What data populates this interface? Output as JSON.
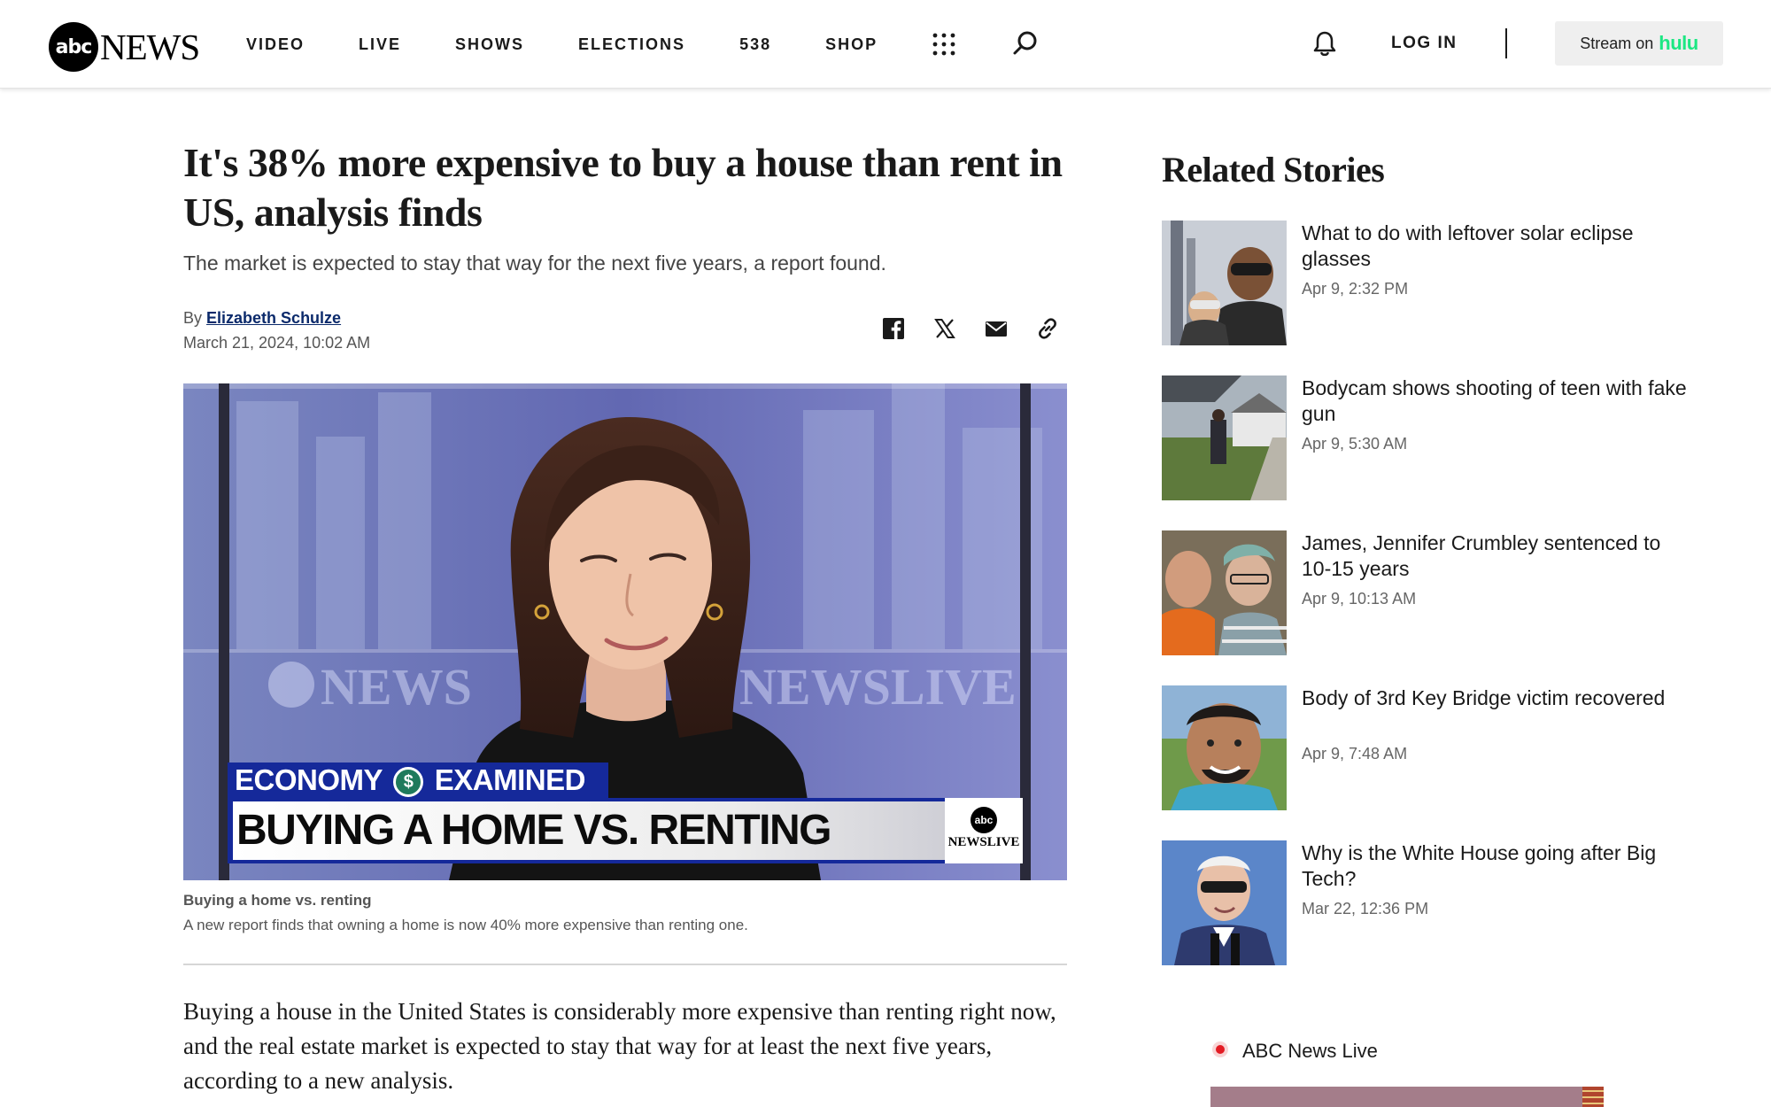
{
  "header": {
    "logo_mark": "abc",
    "logo_word": "NEWS",
    "nav": [
      "VIDEO",
      "LIVE",
      "SHOWS",
      "ELECTIONS",
      "538",
      "SHOP"
    ],
    "login_label": "LOG IN",
    "stream_prefix": "Stream on",
    "stream_brand": "hulu",
    "icons": [
      "grid-menu-icon",
      "search-icon",
      "bell-icon"
    ]
  },
  "article": {
    "headline": "It's 38% more expensive to buy a house than rent in US, analysis finds",
    "subhead": "The market is expected to stay that way for the next five years, a report found.",
    "byline_prefix": "By",
    "author": "Elizabeth Schulze",
    "date": "March 21, 2024, 10:02 AM",
    "share_icons": [
      "facebook-icon",
      "x-icon",
      "email-icon",
      "link-icon"
    ],
    "hero": {
      "lower_third_top_left": "ECONOMY",
      "lower_third_symbol": "$",
      "lower_third_top_right": "EXAMINED",
      "lower_third_main": "BUYING A HOME VS. RENTING",
      "badge_mark": "abc",
      "badge_text": "NEWSLIVE",
      "backdrop_text_left": "NEWS",
      "backdrop_text_right": "NEWSLIVE"
    },
    "caption_title": "Buying a home vs. renting",
    "caption_text": "A new report finds that owning a home is now 40% more expensive than renting one.",
    "body": "Buying a house in the United States is considerably more expensive than renting right now, and the real estate market is expected to stay that way for at least the next five years, according to a new analysis."
  },
  "related": {
    "title": "Related Stories",
    "stories": [
      {
        "title": "What to do with leftover solar eclipse glasses",
        "date": "Apr 9, 2:32 PM"
      },
      {
        "title": "Bodycam shows shooting of teen with fake gun",
        "date": "Apr 9, 5:30 AM"
      },
      {
        "title": "James, Jennifer Crumbley sentenced to 10-15 years",
        "date": "Apr 9, 10:13 AM"
      },
      {
        "title": "Body of 3rd Key Bridge victim recovered",
        "date": "Apr 9, 7:48 AM"
      },
      {
        "title": "Why is the White House going after Big Tech?",
        "date": "Mar 22, 12:36 PM"
      }
    ]
  },
  "live": {
    "label": "ABC News Live"
  },
  "colors": {
    "author_link": "#0b2a6b",
    "hulu_green": "#1ce783",
    "live_red": "#e31b23",
    "lower_third_blue": "#15299a"
  }
}
